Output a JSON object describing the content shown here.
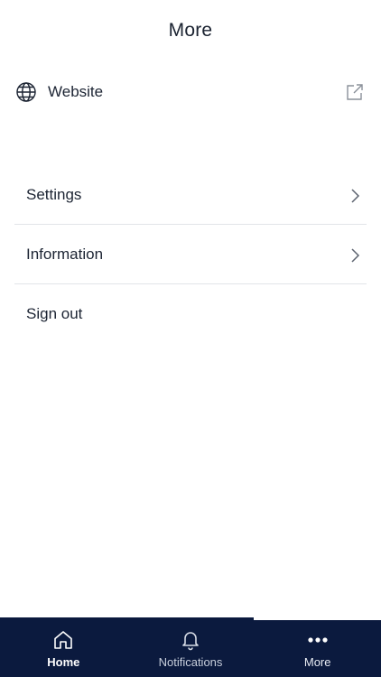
{
  "header": {
    "title": "More"
  },
  "website": {
    "label": "Website",
    "icon": "globe-icon",
    "action_icon": "external-link-icon"
  },
  "menu": {
    "items": [
      {
        "label": "Settings",
        "icon": "chevron-right-icon"
      },
      {
        "label": "Information",
        "icon": "chevron-right-icon"
      },
      {
        "label": "Sign out"
      }
    ]
  },
  "tabbar": {
    "tabs": [
      {
        "label": "Home",
        "icon": "home-icon"
      },
      {
        "label": "Notifications",
        "icon": "bell-icon"
      },
      {
        "label": "More",
        "icon": "more-dots-icon",
        "selected": true
      }
    ]
  },
  "colors": {
    "tabbar_bg": "#0b1a3e",
    "text": "#1c2433",
    "divider": "#e2e4e8"
  }
}
